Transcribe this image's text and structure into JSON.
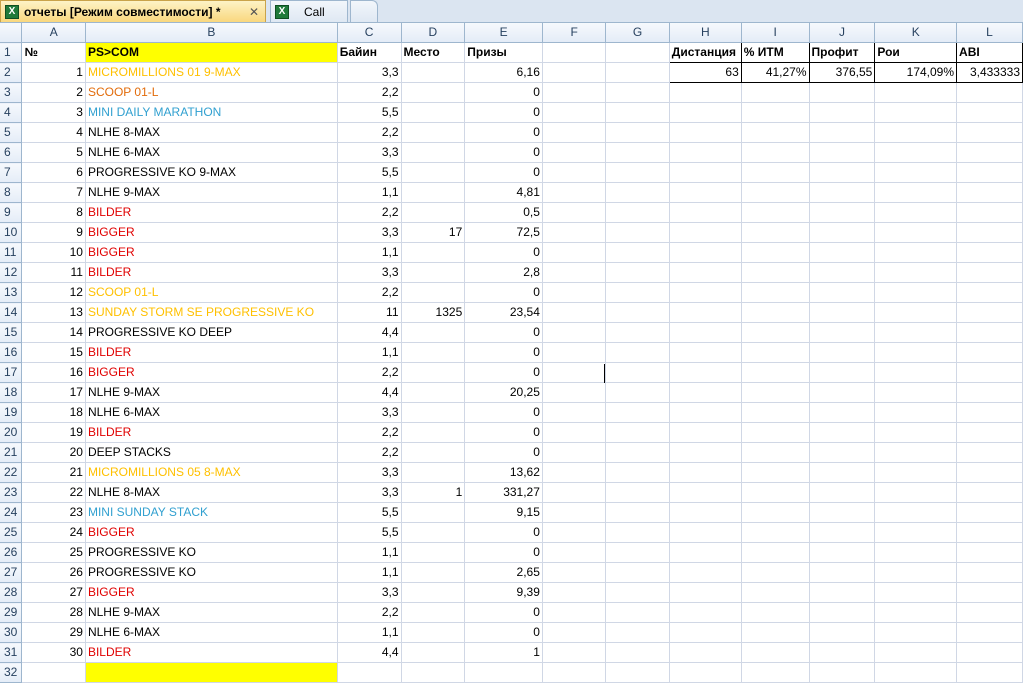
{
  "tabs": [
    {
      "label": "отчеты  [Режим совместимости] *",
      "close": "✕"
    },
    {
      "label": "Call"
    }
  ],
  "columns": [
    "A",
    "B",
    "C",
    "D",
    "E",
    "F",
    "G",
    "H",
    "I",
    "J",
    "K",
    "L"
  ],
  "header_row": {
    "A": "№",
    "B": "PS>COM",
    "C": "Байин",
    "D": "Место",
    "E": "Призы",
    "H": "Дистанция",
    "I": "% ИТМ",
    "J": "Профит",
    "K": "Рои",
    "L": "ABI"
  },
  "stats": {
    "H": "63",
    "I": "41,27%",
    "J": "376,55",
    "K": "174,09%",
    "L": "3,433333"
  },
  "rows": [
    {
      "a": "1",
      "b": "MICROMILLIONS 01 9-MAX",
      "color": "yellow",
      "c": "3,3",
      "d": "",
      "e": "6,16"
    },
    {
      "a": "2",
      "b": "SCOOP 01-L",
      "color": "orange",
      "c": "2,2",
      "d": "",
      "e": "0"
    },
    {
      "a": "3",
      "b": "MINI DAILY MARATHON",
      "color": "blue",
      "c": "5,5",
      "d": "",
      "e": "0"
    },
    {
      "a": "4",
      "b": "NLHE 8-MAX",
      "color": "black",
      "c": "2,2",
      "d": "",
      "e": "0"
    },
    {
      "a": "5",
      "b": "NLHE 6-MAX",
      "color": "black",
      "c": "3,3",
      "d": "",
      "e": "0"
    },
    {
      "a": "6",
      "b": "PROGRESSIVE KO 9-MAX",
      "color": "black",
      "c": "5,5",
      "d": "",
      "e": "0"
    },
    {
      "a": "7",
      "b": "NLHE 9-MAX",
      "color": "black",
      "c": "1,1",
      "d": "",
      "e": "4,81"
    },
    {
      "a": "8",
      "b": "BILDER",
      "color": "red",
      "c": "2,2",
      "d": "",
      "e": "0,5"
    },
    {
      "a": "9",
      "b": "BIGGER",
      "color": "red",
      "c": "3,3",
      "d": "17",
      "e": "72,5"
    },
    {
      "a": "10",
      "b": "BIGGER",
      "color": "red",
      "c": "1,1",
      "d": "",
      "e": "0"
    },
    {
      "a": "11",
      "b": "BILDER",
      "color": "red",
      "c": "3,3",
      "d": "",
      "e": "2,8"
    },
    {
      "a": "12",
      "b": "SCOOP 01-L",
      "color": "yellow",
      "c": "2,2",
      "d": "",
      "e": "0"
    },
    {
      "a": "13",
      "b": "SUNDAY STORM SE PROGRESSIVE KO",
      "color": "yellow",
      "c": "11",
      "d": "1325",
      "e": "23,54"
    },
    {
      "a": "14",
      "b": "PROGRESSIVE KO DEEP",
      "color": "black",
      "c": "4,4",
      "d": "",
      "e": "0"
    },
    {
      "a": "15",
      "b": "BILDER",
      "color": "red",
      "c": "1,1",
      "d": "",
      "e": "0"
    },
    {
      "a": "16",
      "b": "BIGGER",
      "color": "red",
      "c": "2,2",
      "d": "",
      "e": "0"
    },
    {
      "a": "17",
      "b": "NLHE 9-MAX",
      "color": "black",
      "c": "4,4",
      "d": "",
      "e": "20,25"
    },
    {
      "a": "18",
      "b": "NLHE 6-MAX",
      "color": "black",
      "c": "3,3",
      "d": "",
      "e": "0"
    },
    {
      "a": "19",
      "b": "BILDER",
      "color": "red",
      "c": "2,2",
      "d": "",
      "e": "0"
    },
    {
      "a": "20",
      "b": "DEEP STACKS",
      "color": "black",
      "c": "2,2",
      "d": "",
      "e": "0"
    },
    {
      "a": "21",
      "b": "MICROMILLIONS 05 8-MAX",
      "color": "yellow",
      "c": "3,3",
      "d": "",
      "e": "13,62"
    },
    {
      "a": "22",
      "b": "NLHE 8-MAX",
      "color": "black",
      "c": "3,3",
      "d": "1",
      "e": "331,27"
    },
    {
      "a": "23",
      "b": "MINI SUNDAY STACK",
      "color": "blue",
      "c": "5,5",
      "d": "",
      "e": "9,15"
    },
    {
      "a": "24",
      "b": "BIGGER",
      "color": "red",
      "c": "5,5",
      "d": "",
      "e": "0"
    },
    {
      "a": "25",
      "b": "PROGRESSIVE KO",
      "color": "black",
      "c": "1,1",
      "d": "",
      "e": "0"
    },
    {
      "a": "26",
      "b": "PROGRESSIVE KO",
      "color": "black",
      "c": "1,1",
      "d": "",
      "e": "2,65"
    },
    {
      "a": "27",
      "b": "BIGGER",
      "color": "red",
      "c": "3,3",
      "d": "",
      "e": "9,39"
    },
    {
      "a": "28",
      "b": "NLHE 9-MAX",
      "color": "black",
      "c": "2,2",
      "d": "",
      "e": "0"
    },
    {
      "a": "29",
      "b": "NLHE 6-MAX",
      "color": "black",
      "c": "1,1",
      "d": "",
      "e": "0"
    },
    {
      "a": "30",
      "b": "BILDER",
      "color": "red",
      "c": "4,4",
      "d": "",
      "e": "1"
    }
  ],
  "colors": {
    "yellow": "#ffc000",
    "orange": "#e26b0a",
    "blue": "#31a0d0",
    "red": "#e00000",
    "header_fill": "#ffff00"
  }
}
